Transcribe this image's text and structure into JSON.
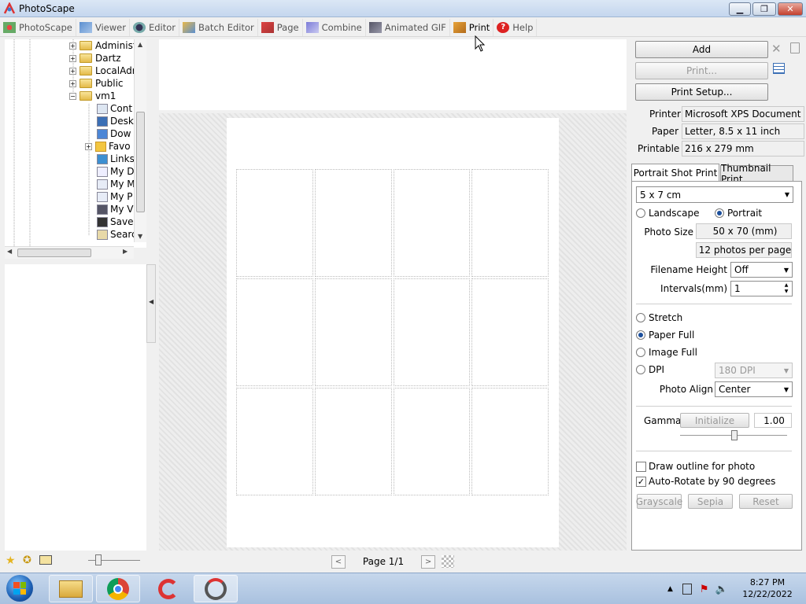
{
  "window": {
    "title": "PhotoScape"
  },
  "menu": {
    "items": [
      {
        "label": "PhotoScape",
        "icon": "photoscape-icon"
      },
      {
        "label": "Viewer",
        "icon": "viewer-icon"
      },
      {
        "label": "Editor",
        "icon": "editor-icon"
      },
      {
        "label": "Batch Editor",
        "icon": "batch-editor-icon"
      },
      {
        "label": "Page",
        "icon": "page-icon"
      },
      {
        "label": "Combine",
        "icon": "combine-icon"
      },
      {
        "label": "Animated GIF",
        "icon": "animated-gif-icon"
      },
      {
        "label": "Print",
        "icon": "print-icon"
      },
      {
        "label": "Help",
        "icon": "help-icon"
      }
    ]
  },
  "tree": {
    "items": [
      "Administ",
      "Dartz",
      "LocalAdr",
      "Public",
      "vm1",
      "Cont",
      "Desk",
      "Dow",
      "Favo",
      "Links",
      "My D",
      "My M",
      "My P",
      "My V",
      "Save",
      "Searc"
    ]
  },
  "buttons": {
    "add": "Add",
    "print": "Print...",
    "print_setup": "Print Setup..."
  },
  "printer_info": {
    "printer_label": "Printer",
    "printer_value": "Microsoft XPS Document Wr",
    "paper_label": "Paper",
    "paper_value": "Letter, 8.5 x 11 inch",
    "printable_label": "Printable",
    "printable_value": "216 x 279 mm"
  },
  "tabs": {
    "portrait": "Portrait Shot Print",
    "thumbnail": "Thumbnail Print"
  },
  "settings": {
    "size_value": "5 x 7 cm",
    "landscape": "Landscape",
    "portrait": "Portrait",
    "photo_size_label": "Photo Size",
    "photo_size_value": "50 x 70 (mm)",
    "photos_per_page": "12 photos per page",
    "filename_height_label": "Filename Height",
    "filename_height_value": "Off",
    "intervals_label": "Intervals(mm)",
    "intervals_value": "1",
    "stretch": "Stretch",
    "paper_full": "Paper Full",
    "image_full": "Image Full",
    "dpi": "DPI",
    "dpi_value": "180 DPI",
    "photo_align_label": "Photo Align",
    "photo_align_value": "Center",
    "gamma_label": "Gamma",
    "initialize": "Initialize",
    "gamma_value": "1.00",
    "draw_outline": "Draw outline for photo",
    "auto_rotate": "Auto-Rotate by 90 degrees",
    "grayscale": "Grayscale",
    "sepia": "Sepia",
    "reset": "Reset"
  },
  "pager": {
    "label": "Page 1/1"
  },
  "clock": {
    "time": "8:27 PM",
    "date": "12/22/2022"
  }
}
